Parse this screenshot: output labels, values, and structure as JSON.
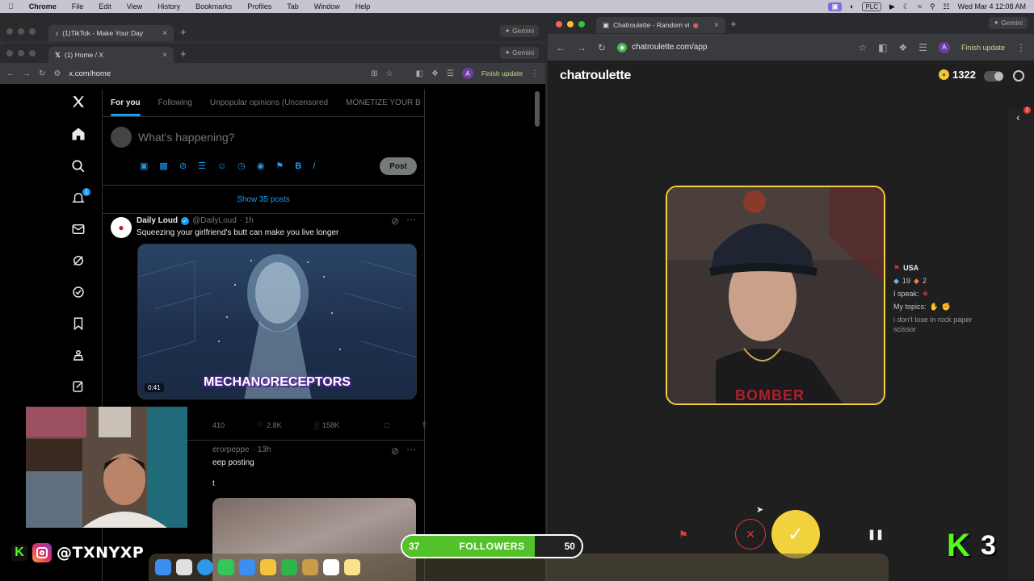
{
  "menubar": {
    "app": "Chrome",
    "items": [
      "File",
      "Edit",
      "View",
      "History",
      "Bookmarks",
      "Profiles",
      "Tab",
      "Window",
      "Help"
    ],
    "status_badge": "PLC",
    "clock": "Wed Mar 4  12:08 AM"
  },
  "tiktok_window": {
    "tab_title": "(1)TikTok - Make Your Day",
    "gemini": "Gemini"
  },
  "x_window": {
    "tab_title": "(1) Home / X",
    "gemini": "Gemini",
    "url": "x.com/home",
    "finish_update": "Finish update",
    "profile_initial": "A",
    "nav_badge": "1",
    "tabs": [
      "For you",
      "Following",
      "Unpopular opinions (Uncensored",
      "MONETIZE YOUR B"
    ],
    "composer_placeholder": "What's happening?",
    "post_button": "Post",
    "show_posts": "Show 35 posts",
    "tweet1": {
      "name": "Daily Loud",
      "handle": "@DailyLoud",
      "time": "· 1h",
      "text": "Squeezing your girlfriend's butt can make you live longer",
      "video_caption": "MECHANORECEPTORS",
      "video_duration": "0:41",
      "replies": "410",
      "likes": "2.8K",
      "views": "158K"
    },
    "tweet2": {
      "handle_partial": "erorpeppe",
      "time": "· 13h",
      "text_partial": "eep posting",
      "extra": "t"
    }
  },
  "chatroulette_window": {
    "tab_title": "Chatroulette - Random vi",
    "gemini": "Gemini",
    "url": "chatroulette.com/app",
    "finish_update": "Finish update",
    "profile_initial": "A",
    "logo": "chatroulette",
    "coins": "1322",
    "notification_badge": "2",
    "profile": {
      "country": "USA",
      "stat_a": "19",
      "stat_b": "2",
      "speak_label": "I speak:",
      "topics_label": "My topics:",
      "bio": "i don't lose in rock paper scissor"
    },
    "video_shirt_text": "BOMBER"
  },
  "overlay": {
    "handle": "@TXNYXP",
    "followers_current": "37",
    "followers_label": "FOLLOWERS",
    "followers_goal": "50",
    "followers_progress": 0.74,
    "kick_count": "3"
  },
  "colors": {
    "x_blue": "#1d9bf0",
    "chatroulette_yellow": "#f2d23c",
    "kick_green": "#53fc18",
    "followers_green": "#53c12a"
  }
}
